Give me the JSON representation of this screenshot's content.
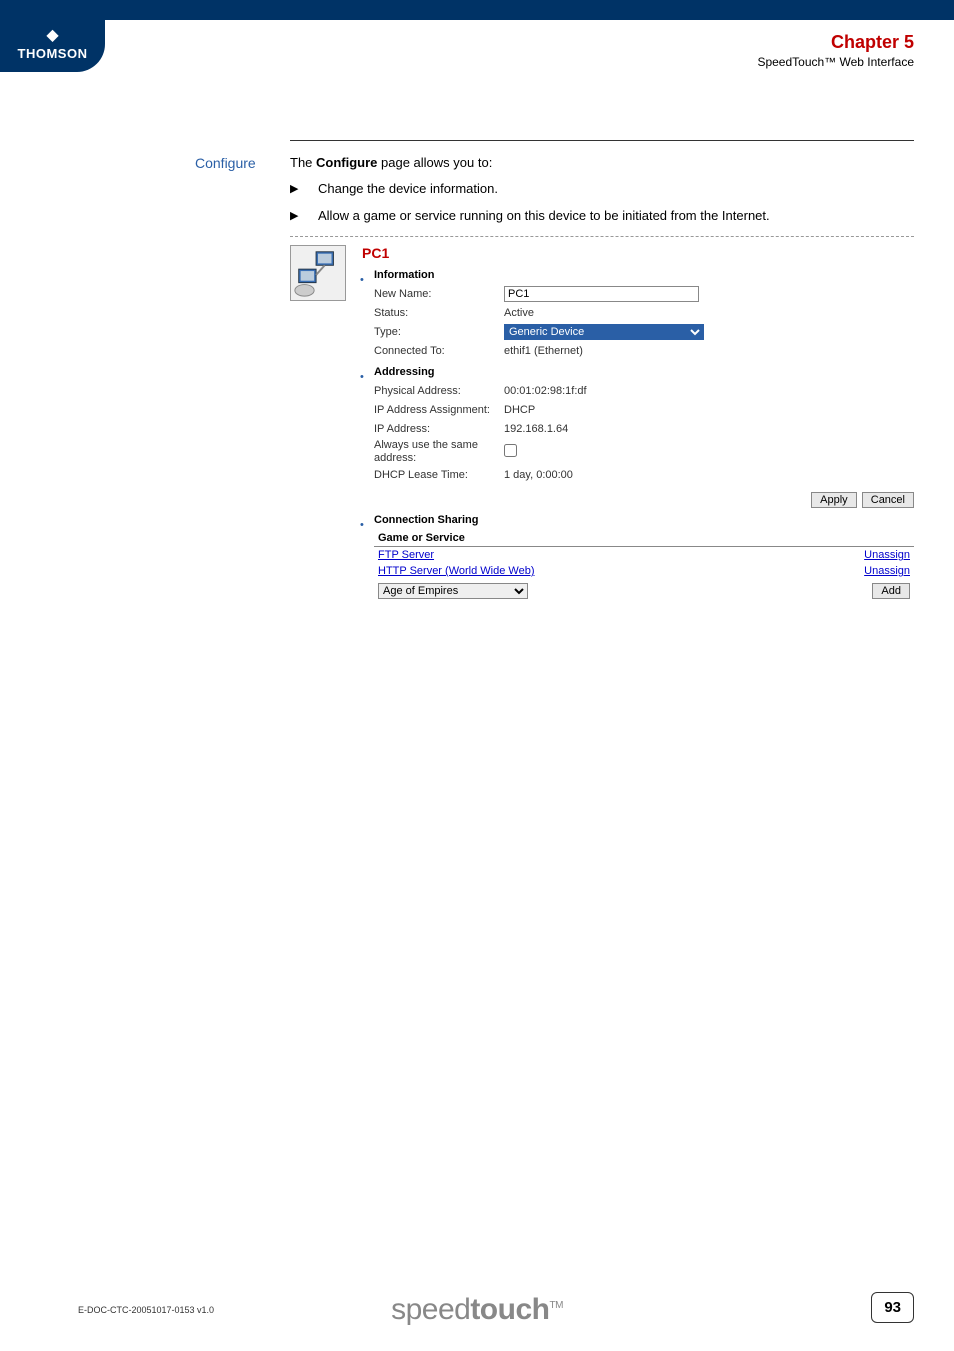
{
  "header": {
    "logo_brand": "THOMSON",
    "chapter": "Chapter 5",
    "subtitle": "SpeedTouch™ Web Interface"
  },
  "section_label": "Configure",
  "intro": {
    "prefix": "The ",
    "bold": "Configure",
    "suffix": " page allows you to:"
  },
  "bullets": [
    "Change the device information.",
    "Allow a game or service running on this device to be initiated from the Internet."
  ],
  "device": {
    "title": "PC1",
    "sections": {
      "information": {
        "heading": "Information",
        "rows": {
          "new_name_label": "New Name:",
          "new_name_value": "PC1",
          "status_label": "Status:",
          "status_value": "Active",
          "type_label": "Type:",
          "type_value": "Generic Device",
          "connected_label": "Connected To:",
          "connected_value": "ethif1 (Ethernet)"
        }
      },
      "addressing": {
        "heading": "Addressing",
        "rows": {
          "phys_label": "Physical Address:",
          "phys_value": "00:01:02:98:1f:df",
          "ipassign_label": "IP Address Assignment:",
          "ipassign_value": "DHCP",
          "ip_label": "IP Address:",
          "ip_value": "192.168.1.64",
          "same_label": "Always use the same address:",
          "lease_label": "DHCP Lease Time:",
          "lease_value": "1 day, 0:00:00"
        }
      },
      "buttons": {
        "apply": "Apply",
        "cancel": "Cancel"
      },
      "connection_sharing": {
        "heading": "Connection Sharing",
        "table_header": "Game or Service",
        "rows": [
          {
            "name": "FTP Server",
            "action": "Unassign"
          },
          {
            "name": "HTTP Server (World Wide Web)",
            "action": "Unassign"
          }
        ],
        "add_select_value": "Age of Empires",
        "add_button": "Add"
      }
    }
  },
  "footer": {
    "doc_id": "E-DOC-CTC-20051017-0153 v1.0",
    "logo_light": "speed",
    "logo_bold": "touch",
    "logo_tm": "TM",
    "page": "93"
  }
}
